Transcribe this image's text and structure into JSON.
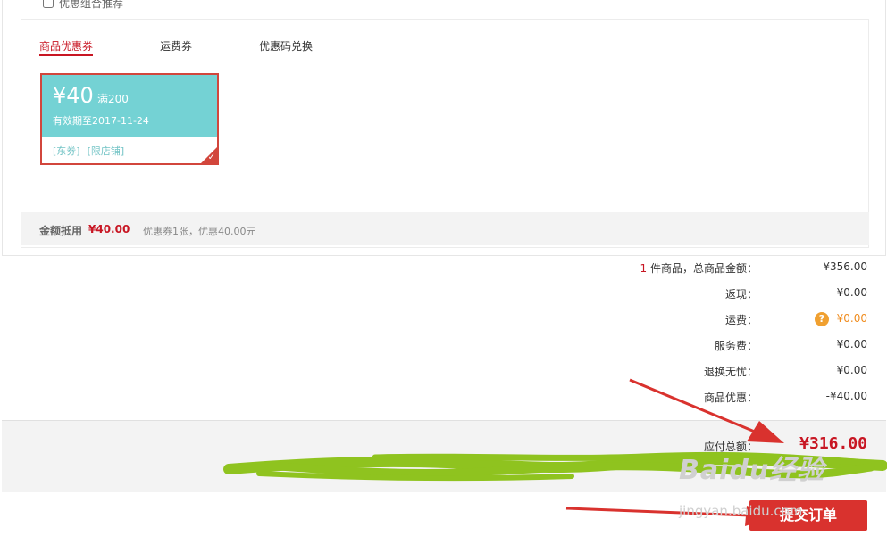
{
  "combo": {
    "label": "优惠组合推荐"
  },
  "tabs": [
    {
      "label": "商品优惠券",
      "active": true
    },
    {
      "label": "运费券",
      "active": false
    },
    {
      "label": "优惠码兑换",
      "active": false
    }
  ],
  "coupon": {
    "amount": "¥40",
    "condition": "满200",
    "valid_until": "有效期至2017-11-24",
    "tags": [
      "[东券]",
      "[限店铺]"
    ],
    "selected": true,
    "colors": {
      "card": "#74d2d4",
      "border": "#d2463c"
    }
  },
  "deduction": {
    "label": "金额抵用",
    "value": "¥40.00",
    "desc": "优惠券1张，优惠40.00元"
  },
  "summary": {
    "count": "1",
    "count_suffix": "件商品，总商品金额：",
    "goods_total": "¥356.00",
    "rows": [
      {
        "label": "返现：",
        "value": "-¥0.00"
      },
      {
        "label": "运费：",
        "value": "¥0.00",
        "help_icon": "question-icon"
      },
      {
        "label": "服务费：",
        "value": "¥0.00"
      },
      {
        "label": "退换无忧：",
        "value": "¥0.00"
      },
      {
        "label": "商品优惠：",
        "value": "-¥40.00"
      }
    ]
  },
  "total": {
    "label": "应付总额：",
    "value": "¥316.00"
  },
  "submit": {
    "label": "提交订单"
  },
  "watermark": {
    "text": "Baidu经验",
    "url": "jingyan.baidu.com"
  },
  "theme": {
    "accent": "#c81623",
    "button": "#d9322e",
    "scribble": "#8fc31f",
    "arrow": "#d9322e"
  }
}
